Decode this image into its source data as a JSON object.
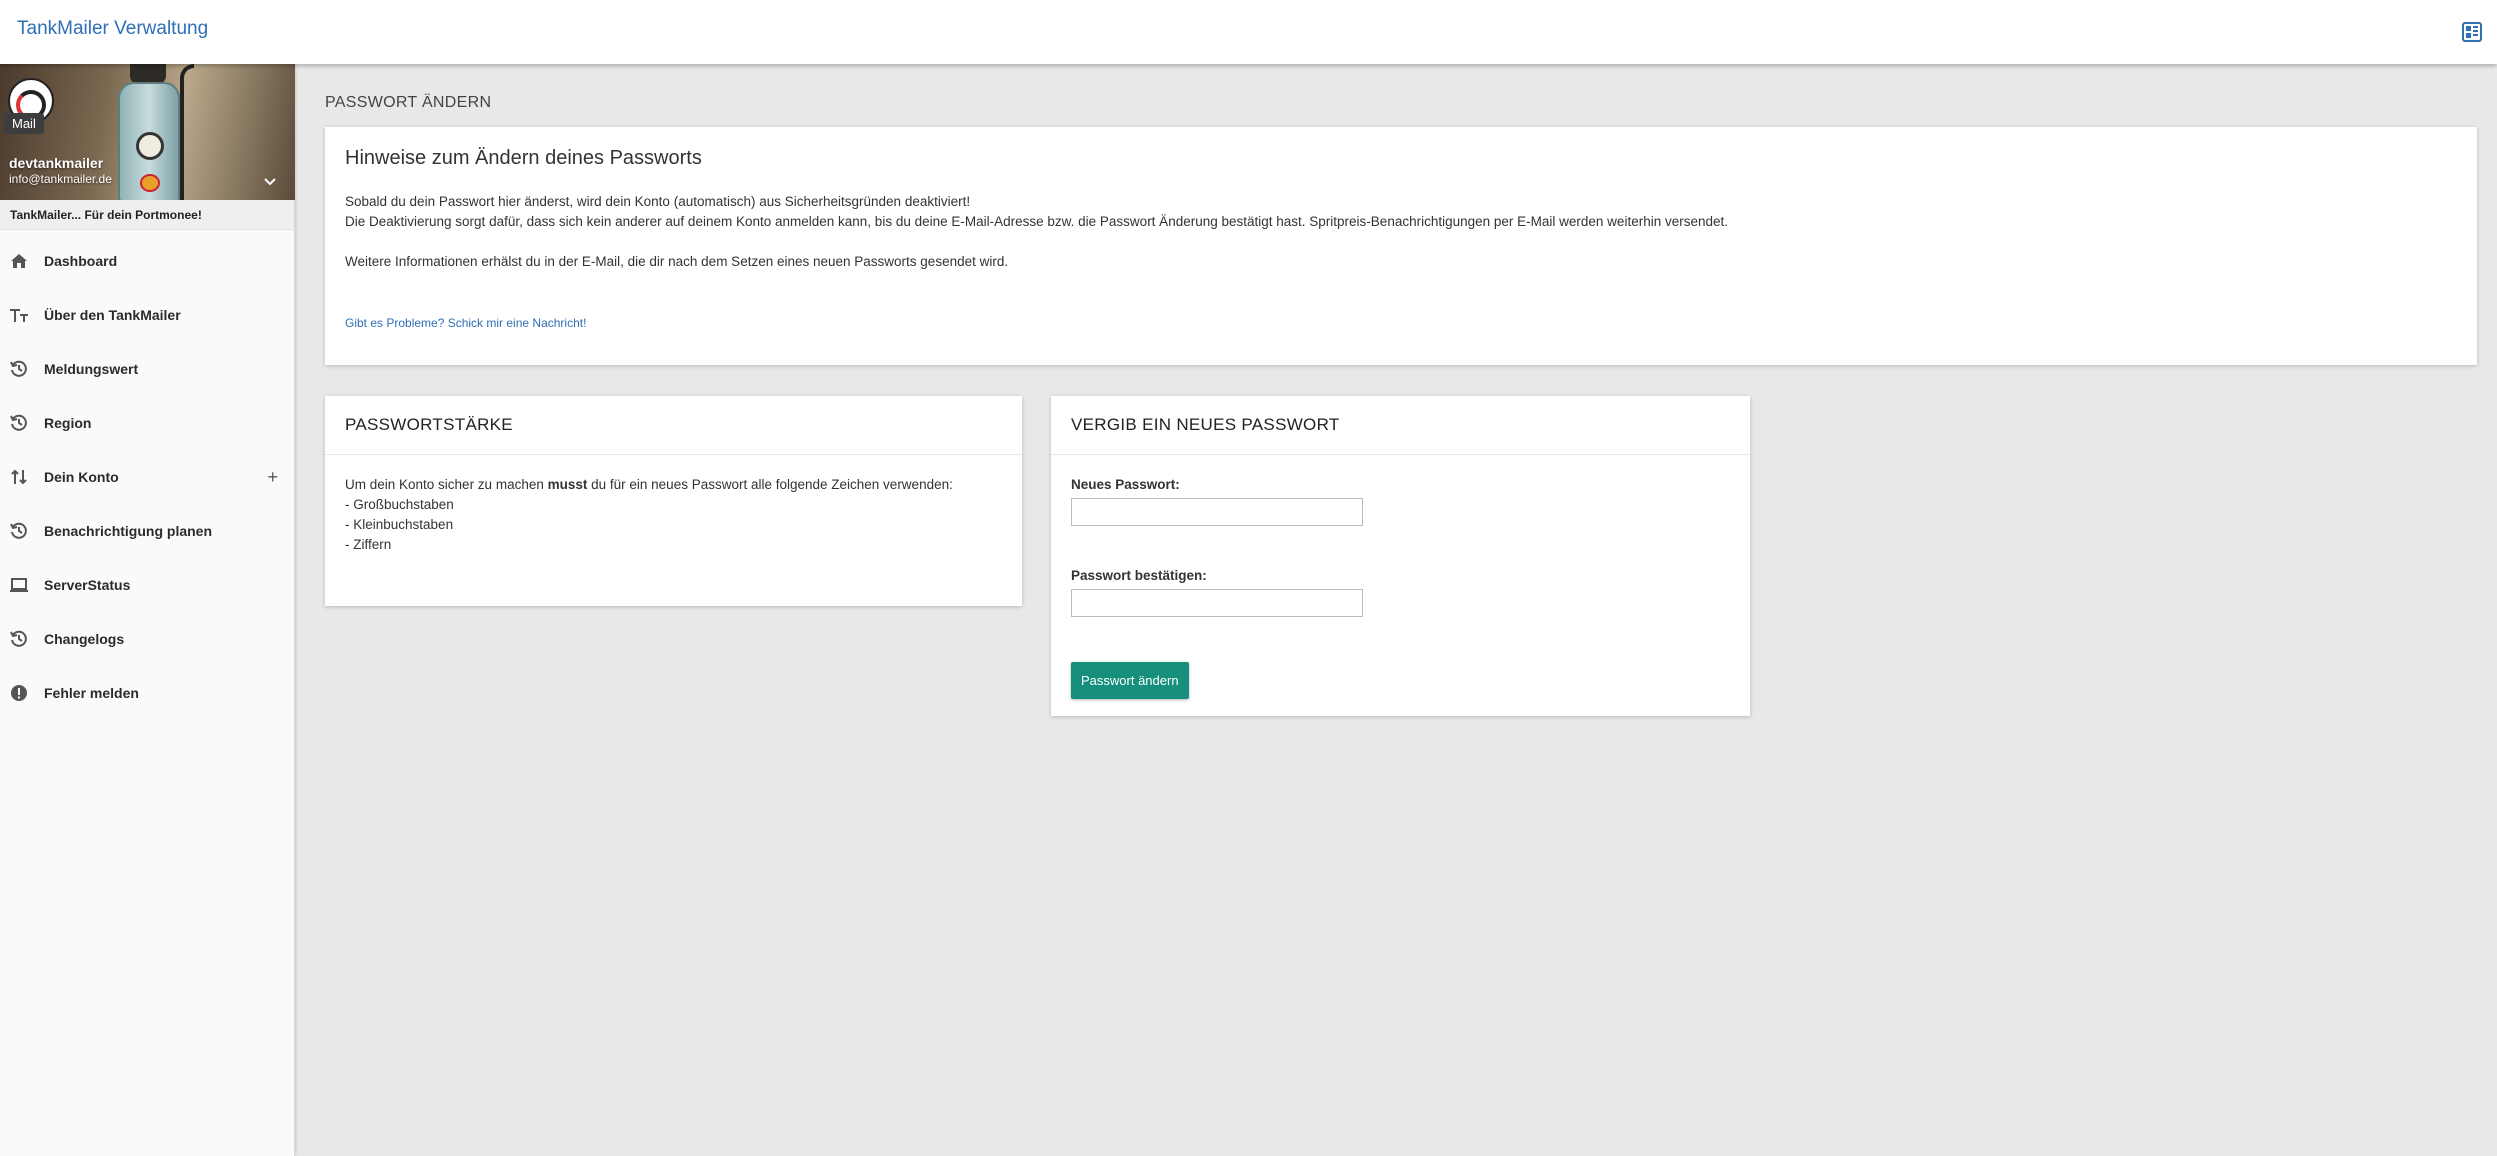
{
  "app": {
    "title": "TankMailer Verwaltung",
    "accent_color": "#2f6fb5",
    "top_icon": "dashboard-grid-icon"
  },
  "profile": {
    "avatar_badge": "Mail",
    "username": "devtankmailer",
    "email": "info@tankmailer.de",
    "slogan": "TankMailer... Für dein Portmonee!"
  },
  "sidebar": {
    "items": [
      {
        "label": "Dashboard",
        "icon": "home-icon"
      },
      {
        "label": "Über den TankMailer",
        "icon": "text-size-icon"
      },
      {
        "label": "Meldungswert",
        "icon": "history-icon"
      },
      {
        "label": "Region",
        "icon": "history-icon"
      },
      {
        "label": "Dein Konto",
        "icon": "swap-icon",
        "expand": "+"
      },
      {
        "label": "Benachrichtigung planen",
        "icon": "history-icon"
      },
      {
        "label": "ServerStatus",
        "icon": "laptop-icon"
      },
      {
        "label": "Changelogs",
        "icon": "history-icon"
      },
      {
        "label": "Fehler melden",
        "icon": "alert-icon"
      }
    ]
  },
  "main": {
    "page_title": "PASSWORT ÄNDERN",
    "info_card": {
      "title": "Hinweise zum Ändern deines Passworts",
      "line1": "Sobald du dein Passwort hier änderst, wird dein Konto (automatisch) aus Sicherheitsgründen deaktiviert!",
      "line2": "Die Deaktivierung sorgt dafür, dass sich kein anderer auf deinem Konto anmelden kann, bis du deine E-Mail-Adresse bzw. die Passwort Änderung bestätigt hast. Spritpreis-Benachrichtigungen per E-Mail werden weiterhin versendet.",
      "line3": "Weitere Informationen erhälst du in der E-Mail, die dir nach dem Setzen eines neuen Passworts gesendet wird.",
      "help_link": "Gibt es Probleme? Schick mir eine Nachricht!"
    },
    "strength_card": {
      "title": "PASSWORTSTÄRKE",
      "intro_before": "Um dein Konto sicher zu machen ",
      "intro_bold": "musst",
      "intro_after": " du für ein neues Passwort alle folgende Zeichen verwenden:",
      "items": [
        "- Großbuchstaben",
        "- Kleinbuchstaben",
        "- Ziffern"
      ]
    },
    "new_password_card": {
      "title": "VERGIB EIN NEUES PASSWORT",
      "new_label": "Neues Passwort:",
      "new_value": "",
      "confirm_label": "Passwort bestätigen:",
      "confirm_value": "",
      "submit_label": "Passwort ändern",
      "button_color": "#16907d"
    }
  }
}
